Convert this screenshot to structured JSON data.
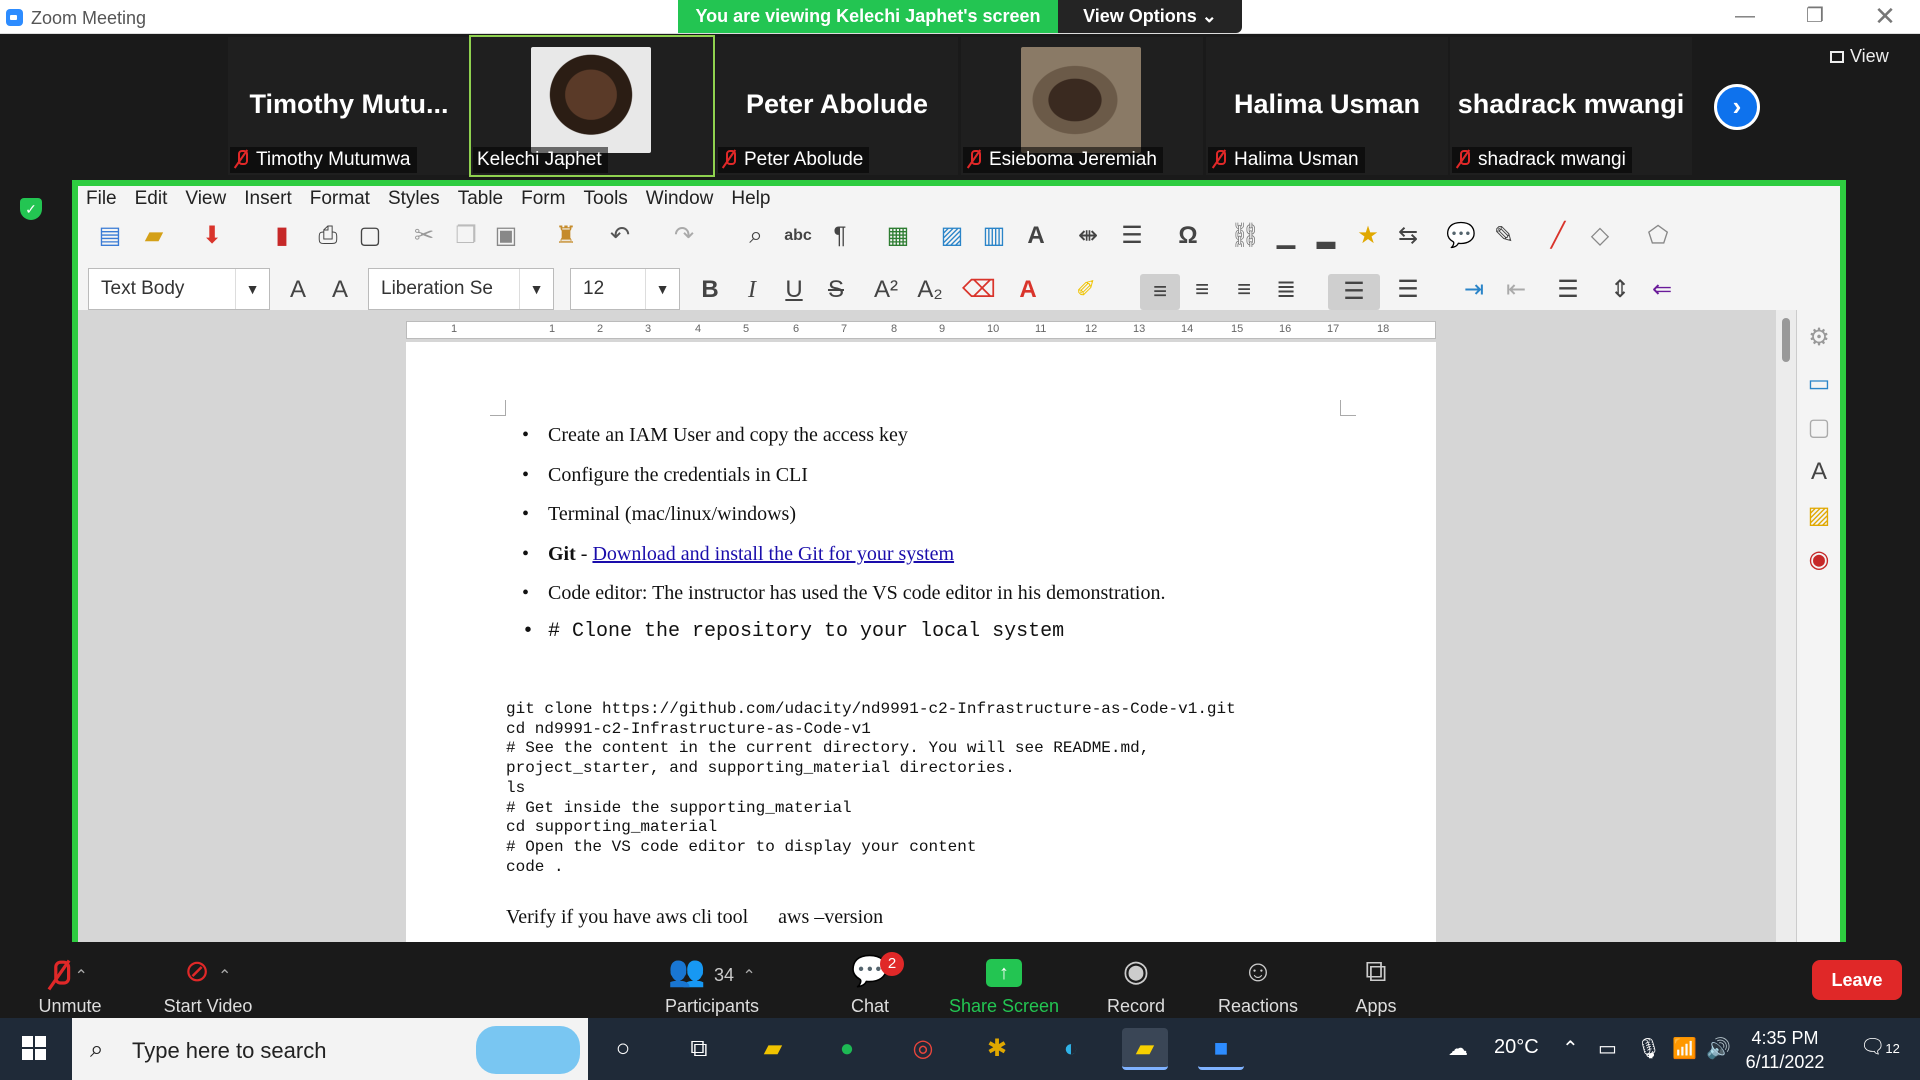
{
  "window": {
    "title": "Zoom Meeting",
    "banner": "You are viewing Kelechi Japhet's screen",
    "view_options": "View Options ⌄",
    "view_label": "View"
  },
  "participants": [
    {
      "big": "Timothy  Mutu...",
      "label": "Timothy Mutumwa",
      "muted": true
    },
    {
      "big": "",
      "label": "Kelechi Japhet",
      "muted": false
    },
    {
      "big": "Peter Abolude",
      "label": "Peter Abolude",
      "muted": true
    },
    {
      "big": "",
      "label": "Esieboma Jeremiah",
      "muted": true
    },
    {
      "big": "Halima Usman",
      "label": "Halima Usman",
      "muted": true
    },
    {
      "big": "shadrack mwangi",
      "label": "shadrack mwangi",
      "muted": true
    }
  ],
  "writer": {
    "menu": [
      "File",
      "Edit",
      "View",
      "Insert",
      "Format",
      "Styles",
      "Table",
      "Form",
      "Tools",
      "Window",
      "Help"
    ],
    "paragraph_style": "Text Body",
    "font_name": "Liberation Se",
    "font_size": "12",
    "ruler": [
      "1",
      "1",
      "2",
      "3",
      "4",
      "5",
      "6",
      "7",
      "8",
      "9",
      "10",
      "11",
      "12",
      "13",
      "14",
      "15",
      "16",
      "17",
      "18"
    ]
  },
  "document": {
    "bullets": [
      "Create an IAM User and copy the access key",
      "Configure the credentials in CLI",
      "Terminal (mac/linux/windows)",
      "Code editor: The instructor has used the VS code editor in his demonstration."
    ],
    "git_label": "Git",
    "git_sep": " - ",
    "git_link": "Download and install the Git for your system",
    "clone_heading": "# Clone the repository to your local system",
    "code": "git clone https://github.com/udacity/nd9991-c2-Infrastructure-as-Code-v1.git\ncd nd9991-c2-Infrastructure-as-Code-v1\n# See the content in the current directory. You will see README.md,\nproject_starter, and supporting_material directories.\nls\n# Get inside the supporting_material\ncd supporting_material\n# Open the VS code editor to display your content\ncode .",
    "verify": "Verify if you have aws cli tool      aws –version"
  },
  "controls": {
    "unmute": "Unmute",
    "start_video": "Start Video",
    "participants_count": "34",
    "participants": "Participants",
    "chat": "Chat",
    "chat_badge": "2",
    "share_screen": "Share Screen",
    "record": "Record",
    "reactions": "Reactions",
    "apps": "Apps",
    "leave": "Leave"
  },
  "taskbar": {
    "search_placeholder": "Type here to search",
    "weather": "20°C",
    "time": "4:35 PM",
    "date": "6/11/2022",
    "notifications": "12"
  },
  "colors": {
    "zoom_green": "#23c552",
    "zoom_blue": "#0e72ed",
    "leave_red": "#e02828"
  }
}
